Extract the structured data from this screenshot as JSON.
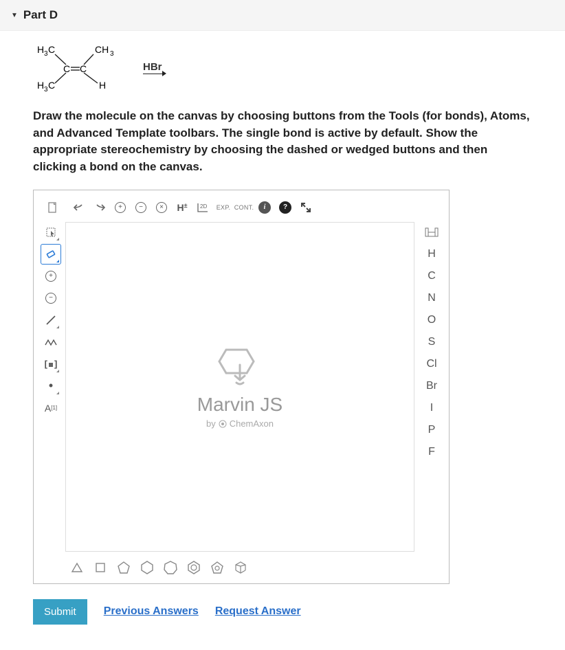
{
  "header": {
    "title": "Part D"
  },
  "reaction": {
    "reagent": "HBr",
    "labels": {
      "h3c_tl": "H₃C",
      "ch3_tr": "CH₃",
      "h3c_bl": "H₃C",
      "h_br": "H",
      "c_eq_c": "C=C"
    }
  },
  "instructions": "Draw the molecule on the canvas by choosing buttons from the Tools (for bonds), Atoms, and Advanced Template toolbars. The single bond is active by default. Show the appropriate stereochemistry by choosing the dashed or wedged buttons and then clicking a bond on the canvas.",
  "editor": {
    "brand_title": "Marvin JS",
    "brand_by": "by",
    "brand_company": "ChemAxon",
    "top": {
      "h_label": "H",
      "twoD": "2D",
      "exp": "EXP.",
      "cont": "CONT."
    },
    "atoms": [
      "H",
      "C",
      "N",
      "O",
      "S",
      "Cl",
      "Br",
      "I",
      "P",
      "F"
    ],
    "left_atom_map": "A"
  },
  "actions": {
    "submit": "Submit",
    "previous": "Previous Answers",
    "request": "Request Answer"
  }
}
